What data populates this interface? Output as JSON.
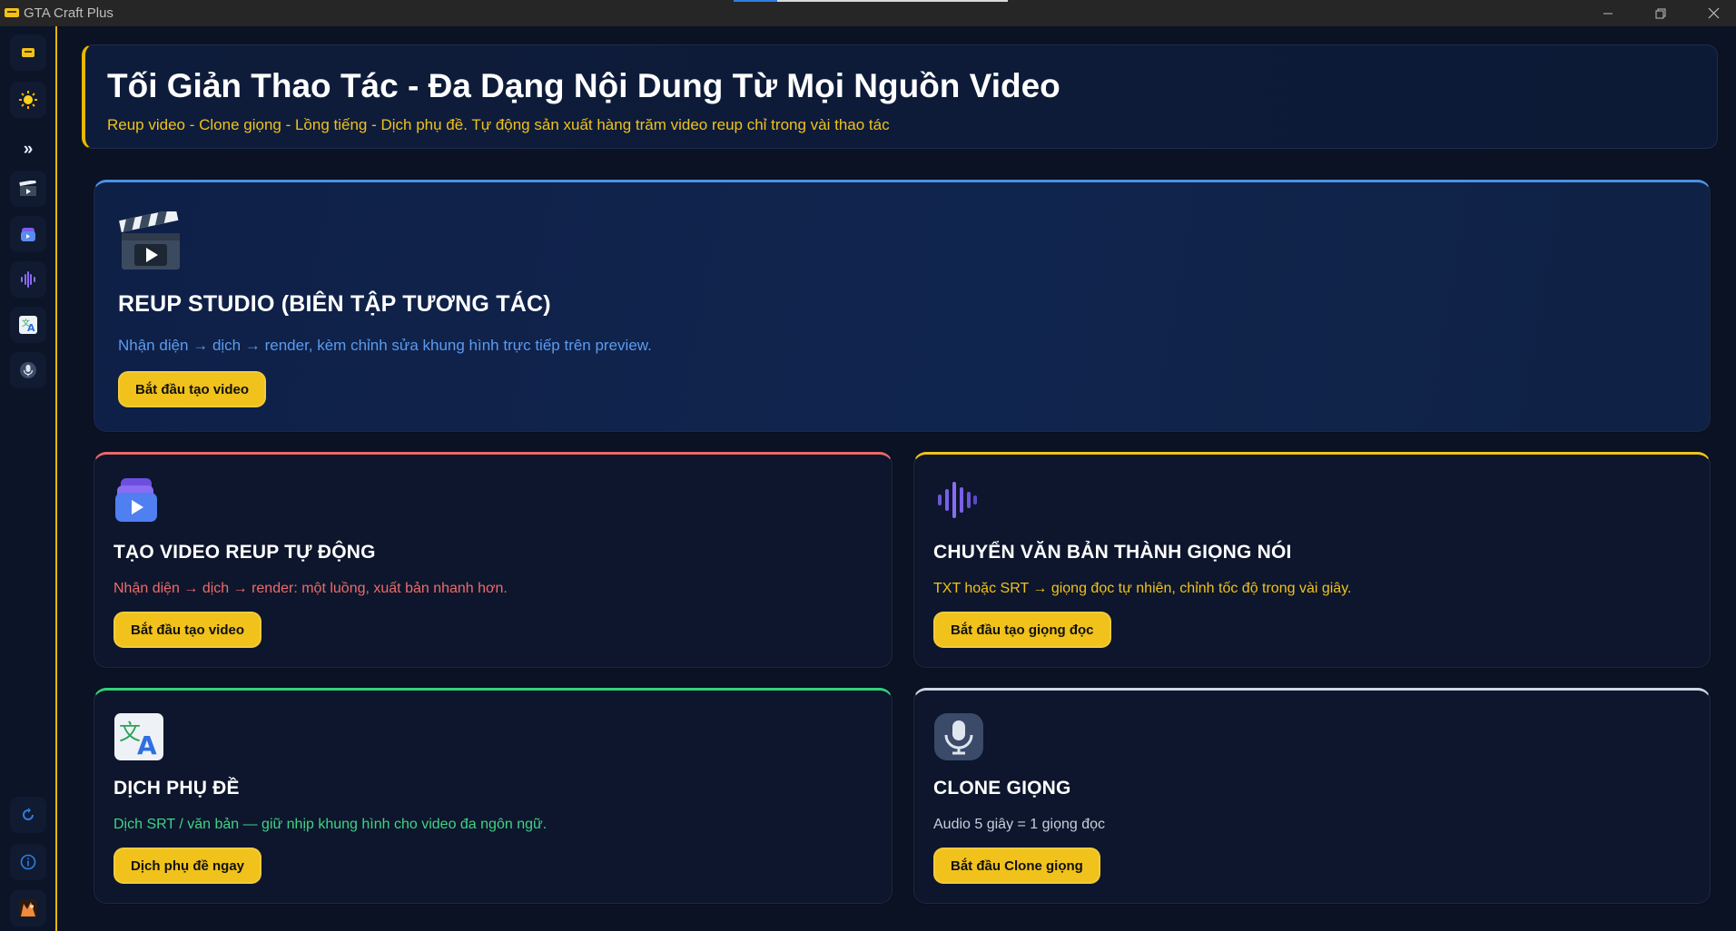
{
  "window": {
    "title": "GTA Craft Plus",
    "loading_progress": 0.16
  },
  "sidebar": {
    "items": [
      {
        "icon": "app-logo-icon"
      },
      {
        "icon": "theme-sun-icon"
      },
      {
        "icon": "expand-chevrons-icon",
        "label": "»"
      },
      {
        "icon": "clapperboard-icon"
      },
      {
        "icon": "video-stack-icon"
      },
      {
        "icon": "waveform-icon"
      },
      {
        "icon": "translate-icon"
      },
      {
        "icon": "microphone-icon"
      },
      {
        "icon": "refresh-icon"
      },
      {
        "icon": "info-icon"
      },
      {
        "icon": "user-avatar-icon"
      }
    ]
  },
  "header": {
    "title": "Tối Giản Thao Tác - Đa Dạng Nội Dung Từ Mọi Nguồn Video",
    "subtitle": "Reup video - Clone giọng - Lồng tiếng - Dịch phụ đề. Tự động sản xuất hàng trăm video reup chỉ trong vài thao tác"
  },
  "cards": {
    "reup_studio": {
      "icon": "clapperboard-icon",
      "title": "REUP STUDIO (BIÊN TẬP TƯƠNG TÁC)",
      "description": "Nhận diện → dịch → render, kèm chỉnh sửa khung hình trực tiếp trên preview.",
      "button": "Bắt đầu tạo video",
      "accent": "#4b92e6",
      "desc_color": "#5b9bf0"
    },
    "auto_reup": {
      "icon": "video-stack-icon",
      "title": "TẠO VIDEO REUP TỰ ĐỘNG",
      "description": "Nhận diện → dịch → render: một luồng, xuất bản nhanh hơn.",
      "button": "Bắt đầu tạo video",
      "accent": "#e66a6a",
      "desc_color": "#ee6b6b"
    },
    "tts": {
      "icon": "waveform-icon",
      "title": "CHUYỂN VĂN BẢN THÀNH GIỌNG NÓI",
      "description": "TXT hoặc SRT → giọng đọc tự nhiên, chỉnh tốc độ trong vài giây.",
      "button": "Bắt đầu tạo giọng đọc",
      "accent": "#f0c21b",
      "desc_color": "#f0c21b"
    },
    "subtitle": {
      "icon": "translate-icon",
      "title": "DỊCH PHỤ ĐỀ",
      "description": "Dịch SRT / văn bản — giữ nhịp khung hình cho video đa ngôn ngữ.",
      "button": "Dịch phụ đề ngay",
      "accent": "#33d17a",
      "desc_color": "#3fd386"
    },
    "clone": {
      "icon": "microphone-icon",
      "title": "CLONE GIỌNG",
      "description": "Audio 5 giây = 1 giọng đọc",
      "button": "Bắt đầu Clone giọng",
      "accent": "#cfd6e4",
      "desc_color": "#c7cfdc"
    }
  },
  "colors": {
    "background": "#0b1224",
    "brand_yellow": "#f0c21b",
    "card_bg": "#0d162c"
  }
}
